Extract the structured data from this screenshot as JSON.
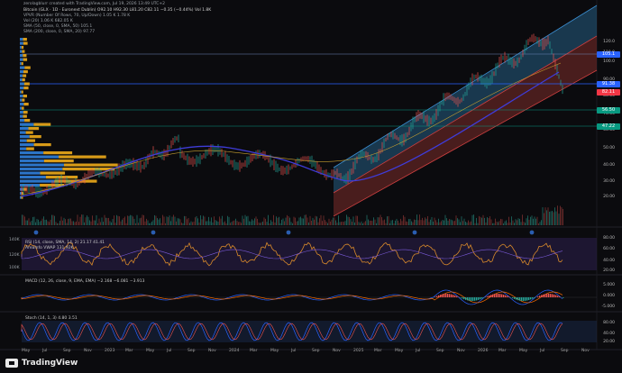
{
  "header": {
    "created_line": "zerolagblurr created with TradingView.com, Jul 19, 2026 13:49 UTC+2",
    "symbol_line": "Bitcoin (GLX · 1D · Euronext Dublin) O92.10 H92.30 L81.20 C82.11 −0.35 (−0.44%) Vol 1.8K",
    "vpvr_line": "VPVR (Number Of Rows, 70, Up/Down) 1.05 K 1.78 K",
    "vol_line": "Vol (20) 1.06 K 682.05 K",
    "sma50_line": "SMA (50, close, 0, SMA, 50) 105.1",
    "sma200_line": "SMA (200, close, 0, SMA, 20) 97.77"
  },
  "axis": {
    "price_ticks": [
      "120.0",
      "110.0",
      "100.0",
      "90.00",
      "80.00",
      "70.00",
      "60.00",
      "50.00",
      "40.00",
      "30.00",
      "20.00"
    ],
    "rsi_ticks": [
      "80.00",
      "60.00",
      "40.00",
      "20.00"
    ],
    "macd_ticks": [
      "5.000",
      "0.000",
      "-5.000"
    ],
    "stoch_ticks": [
      "80.00",
      "40.00",
      "20.00"
    ],
    "left_volume_ticks": [
      "140K",
      "120K",
      "100K"
    ],
    "months": [
      "May",
      "Jul",
      "Sep",
      "Nov",
      "2023",
      "Mar",
      "May",
      "Jul",
      "Sep",
      "Nov",
      "2024",
      "Mar",
      "May",
      "Jul",
      "Sep",
      "Nov",
      "2025",
      "Mar",
      "May",
      "Jul",
      "Sep",
      "Nov",
      "2026",
      "Mar",
      "May",
      "Jul",
      "Sep",
      "Nov"
    ]
  },
  "price_tags": [
    {
      "label": "105.1",
      "color": "#2962ff"
    },
    {
      "label": "91.38",
      "color": "#2962ff"
    },
    {
      "label": "82.11",
      "color": "#f23645"
    },
    {
      "label": "56.50",
      "color": "#089981"
    },
    {
      "label": "47.22",
      "color": "#089981"
    }
  ],
  "panels": {
    "rsi": "RSI (14, close, SMA, 14, 2) 21.17 41.41",
    "rsi_sub": "AreaInfo VWAP 131.92K",
    "macd": "MACD (12, 26, close, 9, EMA, EMA) −2.168 −6.081 −3.913",
    "stoch": "Stoch (14, 1, 3) 4.80 3.51"
  },
  "footer": {
    "brand": "TradingView"
  },
  "colors": {
    "background": "#0b0b0e",
    "channel_blue": "#2a6f9e",
    "channel_red": "#7d2d2a",
    "sma_blue": "#3f3cd9",
    "vpvr_yellow": "#d89b18",
    "vpvr_blue": "#2c74c7"
  }
}
